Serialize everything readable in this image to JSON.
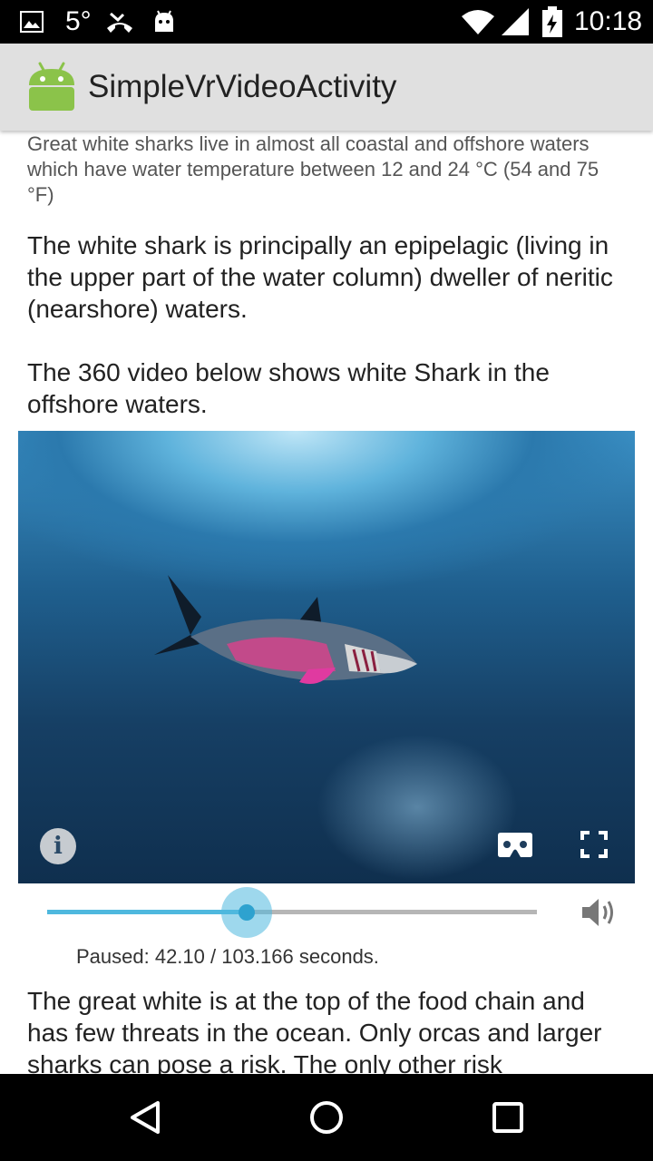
{
  "status_bar": {
    "temperature": "5°",
    "time": "10:18",
    "icons": [
      "image-icon",
      "missed-call-icon",
      "android-debug-icon",
      "wifi-icon",
      "signal-icon",
      "battery-charging-icon"
    ]
  },
  "app_bar": {
    "title": "SimpleVrVideoActivity",
    "icon": "android-robot-icon"
  },
  "content": {
    "intro_text": "Great white sharks live in almost all coastal and offshore waters which have water temperature between 12 and 24 °C (54 and 75 °F)",
    "paragraph_1": "The white shark is principally an epipelagic (living in the upper part of the water column) dweller of neritic (nearshore) waters.",
    "paragraph_2": "The 360 video below shows white Shark in the offshore waters.",
    "paragraph_3": "The great white is at the top of the food chain and has few threats in the ocean. Only orcas and larger sharks can pose a risk. The only other risk"
  },
  "video_player": {
    "controls": [
      "info-icon",
      "cardboard-icon",
      "fullscreen-icon"
    ],
    "seek_progress": 0.408,
    "status_text": "Paused: 42.10 / 103.166 seconds.",
    "volume_icon": "volume-icon",
    "accent_color": "#4fb8de"
  },
  "nav_bar": {
    "buttons": [
      "back-icon",
      "home-icon",
      "recents-icon"
    ]
  }
}
